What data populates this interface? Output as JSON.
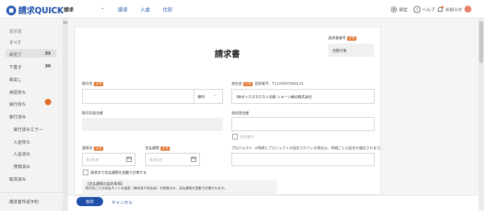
{
  "header": {
    "logo": "請求QUICK",
    "doc_type": "請求",
    "nav": [
      "請求",
      "入金",
      "仕訳"
    ],
    "settings": "設定",
    "help": "ヘルプ",
    "notices": "お知らせ"
  },
  "sidebar": {
    "heading": "請求書",
    "items": [
      {
        "label": "すべて"
      },
      {
        "label": "未完了",
        "count": "33"
      },
      {
        "label": "下書き",
        "count": "30"
      },
      {
        "label": "差戻し"
      },
      {
        "label": "承認待ち"
      },
      {
        "label": "発行待ち",
        "badge": "3"
      },
      {
        "label": "発行済み"
      },
      {
        "label": "発行済みエラー"
      },
      {
        "label": "入金待ち"
      },
      {
        "label": "入金済み"
      },
      {
        "label": "貸倒済み"
      },
      {
        "label": "取消済み"
      }
    ],
    "bottom": "請求書作成予約"
  },
  "form": {
    "title": "請求書",
    "invoice_no_label": "請求書番号",
    "invoice_no_value": "自動付番",
    "required": "必須",
    "customer_label": "取引先",
    "honorific": "御中",
    "company_label": "自社名",
    "reg_number": "登録番号：T1234567890123",
    "company_value": "SBボックスネクストお絵 ショーン様の株式会社",
    "attention_label": "取引先担当者",
    "person_label": "自社担当者",
    "seal": "担当者印",
    "issue_date_label": "請求日",
    "due_date_label": "支払期限",
    "date_placeholder": "年/月/日",
    "project_label": "プロジェクト",
    "project_note": "※明細にプロジェクトが設定されている場合は、明細ごとの設定が優先されます。",
    "checkbox_label": "請求日で支払期限を自動で計算する",
    "note_text": "【支払期限の設定事項】",
    "note_sub": "取引先ごとの支払サイトの設定（締め日や支払日）が反映され、支払期限が自動で計算されます。"
  },
  "footer": {
    "save": "保存",
    "cancel": "キャンセル"
  }
}
